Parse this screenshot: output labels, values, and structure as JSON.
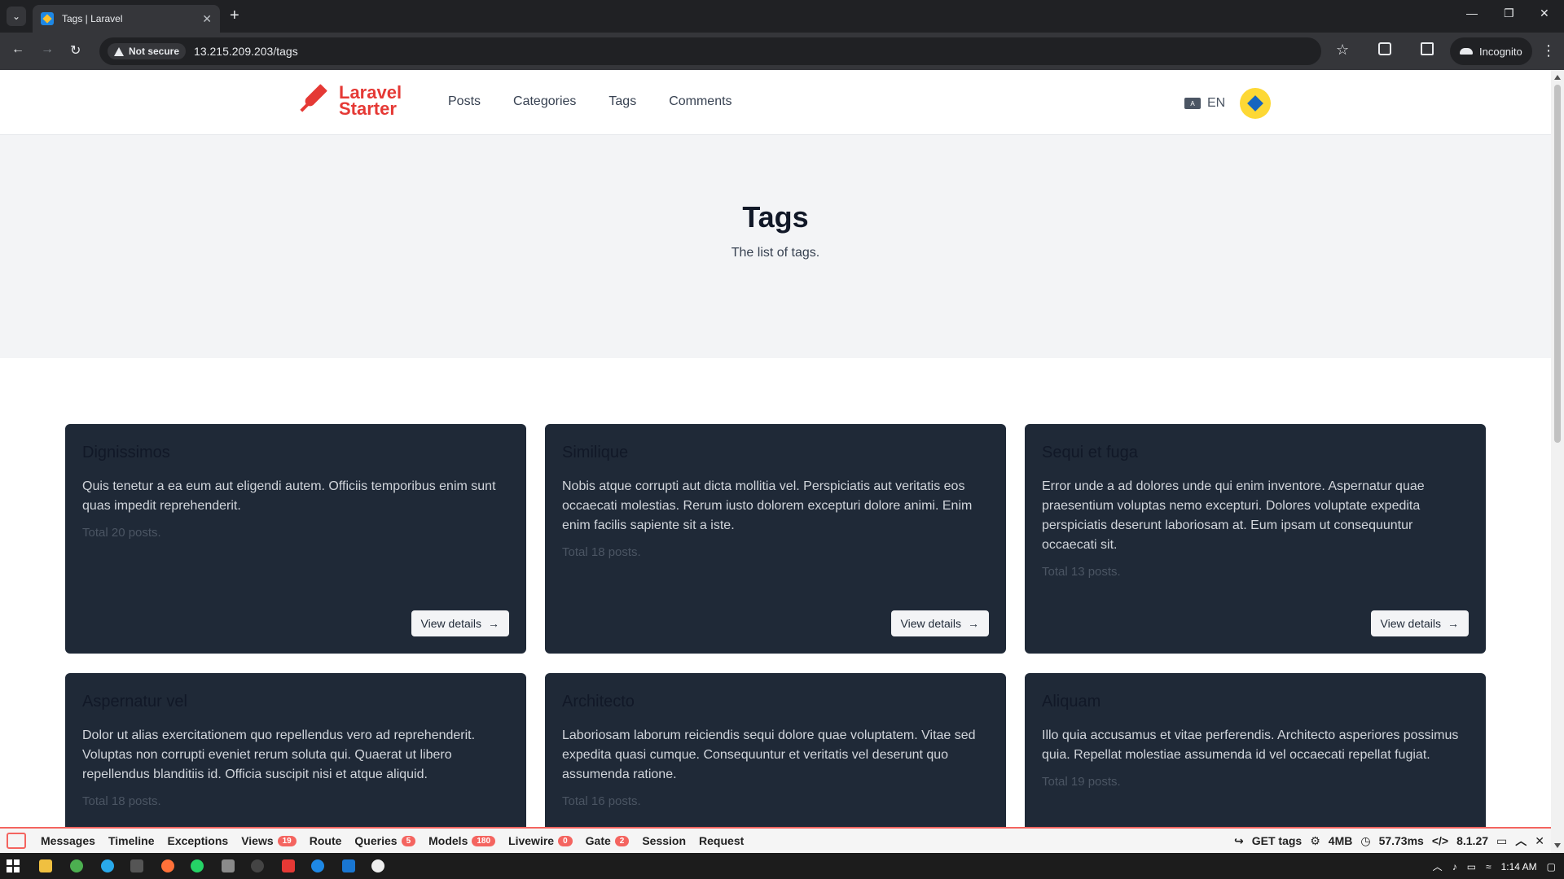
{
  "browser": {
    "tab_title": "Tags | Laravel",
    "security_label": "Not secure",
    "url": "13.215.209.203/tags",
    "incognito_label": "Incognito"
  },
  "header": {
    "logo_line1": "Laravel",
    "logo_line2": "Starter",
    "nav": [
      "Posts",
      "Categories",
      "Tags",
      "Comments"
    ],
    "language": "EN"
  },
  "hero": {
    "title": "Tags",
    "subtitle": "The list of tags."
  },
  "cards": [
    {
      "title": "Dignissimos",
      "description": "Quis tenetur a ea eum aut eligendi autem. Officiis temporibus enim sunt quas impedit reprehenderit.",
      "count": "Total 20 posts.",
      "button": "View details"
    },
    {
      "title": "Similique",
      "description": "Nobis atque corrupti aut dicta mollitia vel. Perspiciatis aut veritatis eos occaecati molestias. Rerum iusto dolorem excepturi dolore animi. Enim enim facilis sapiente sit a iste.",
      "count": "Total 18 posts.",
      "button": "View details"
    },
    {
      "title": "Sequi et fuga",
      "description": "Error unde a ad dolores unde qui enim inventore. Aspernatur quae praesentium voluptas nemo excepturi. Dolores voluptate expedita perspiciatis deserunt laboriosam at. Eum ipsam ut consequuntur occaecati sit.",
      "count": "Total 13 posts.",
      "button": "View details"
    },
    {
      "title": "Aspernatur vel",
      "description": "Dolor ut alias exercitationem quo repellendus vero ad reprehenderit. Voluptas non corrupti eveniet rerum soluta qui. Quaerat ut libero repellendus blanditiis id. Officia suscipit nisi et atque aliquid.",
      "count": "Total 18 posts."
    },
    {
      "title": "Architecto",
      "description": "Laboriosam laborum reiciendis sequi dolore quae voluptatem. Vitae sed expedita quasi cumque. Consequuntur et veritatis vel deserunt quo assumenda ratione.",
      "count": "Total 16 posts."
    },
    {
      "title": "Aliquam",
      "description": "Illo quia accusamus et vitae perferendis. Architecto asperiores possimus quia. Repellat molestiae assumenda id vel occaecati repellat fugiat.",
      "count": "Total 19 posts."
    }
  ],
  "debugbar": {
    "items": [
      {
        "label": "Messages",
        "badge": ""
      },
      {
        "label": "Timeline",
        "badge": ""
      },
      {
        "label": "Exceptions",
        "badge": ""
      },
      {
        "label": "Views",
        "badge": "19"
      },
      {
        "label": "Route",
        "badge": ""
      },
      {
        "label": "Queries",
        "badge": "5"
      },
      {
        "label": "Models",
        "badge": "180"
      },
      {
        "label": "Livewire",
        "badge": "0"
      },
      {
        "label": "Gate",
        "badge": "2"
      },
      {
        "label": "Session",
        "badge": ""
      },
      {
        "label": "Request",
        "badge": ""
      }
    ],
    "request": "GET tags",
    "memory": "4MB",
    "time": "57.73ms",
    "php": "8.1.27"
  },
  "taskbar": {
    "clock": "1:14 AM"
  },
  "colors": {
    "accent": "#e53935",
    "card_bg": "#1f2937",
    "hero_bg": "#f3f4f6",
    "debug_accent": "#f4645f"
  }
}
